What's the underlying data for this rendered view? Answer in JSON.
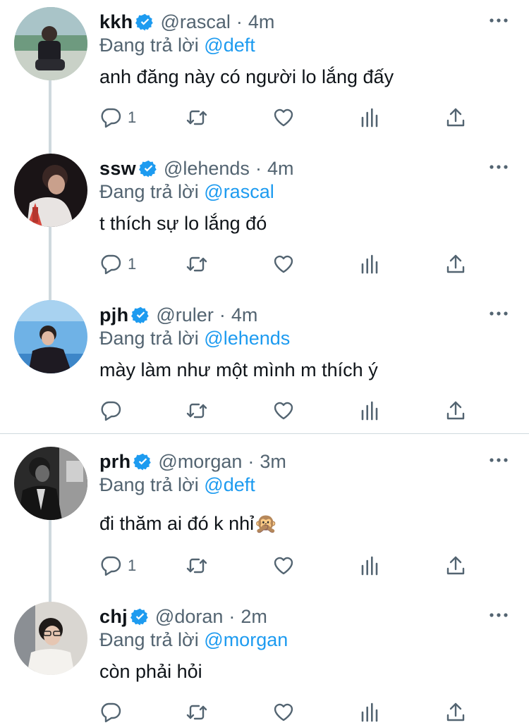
{
  "replying_label": "Đang trả lời",
  "colors": {
    "accent": "#1d9bf0",
    "muted": "#536471",
    "text": "#0f1419",
    "thread": "#cfd9de"
  },
  "tweets": [
    {
      "name": "kkh",
      "handle": "@rascal",
      "sep": "·",
      "time": "4m",
      "reply_to": "@deft",
      "text": "anh đăng này có người lo lắng đấy",
      "reply_count": "1"
    },
    {
      "name": "ssw",
      "handle": "@lehends",
      "sep": "·",
      "time": "4m",
      "reply_to": "@rascal",
      "text": "t thích sự lo lắng đó",
      "reply_count": "1"
    },
    {
      "name": "pjh",
      "handle": "@ruler",
      "sep": "·",
      "time": "4m",
      "reply_to": "@lehends",
      "text": "mày làm như một mình m thích ý",
      "reply_count": ""
    },
    {
      "name": "prh",
      "handle": "@morgan",
      "sep": "·",
      "time": "3m",
      "reply_to": "@deft",
      "text": "đi thăm ai đó k nhỉ",
      "emoji": "🙊",
      "reply_count": "1"
    },
    {
      "name": "chj",
      "handle": "@doran",
      "sep": "·",
      "time": "2m",
      "reply_to": "@morgan",
      "text": "còn phải hỏi",
      "reply_count": ""
    }
  ],
  "icons": {
    "verified": "verified-badge-icon",
    "more": "more-dots-icon",
    "reply": "reply-bubble-icon",
    "retweet": "retweet-icon",
    "like": "heart-icon",
    "analytics": "analytics-bars-icon",
    "share": "share-upload-icon"
  }
}
